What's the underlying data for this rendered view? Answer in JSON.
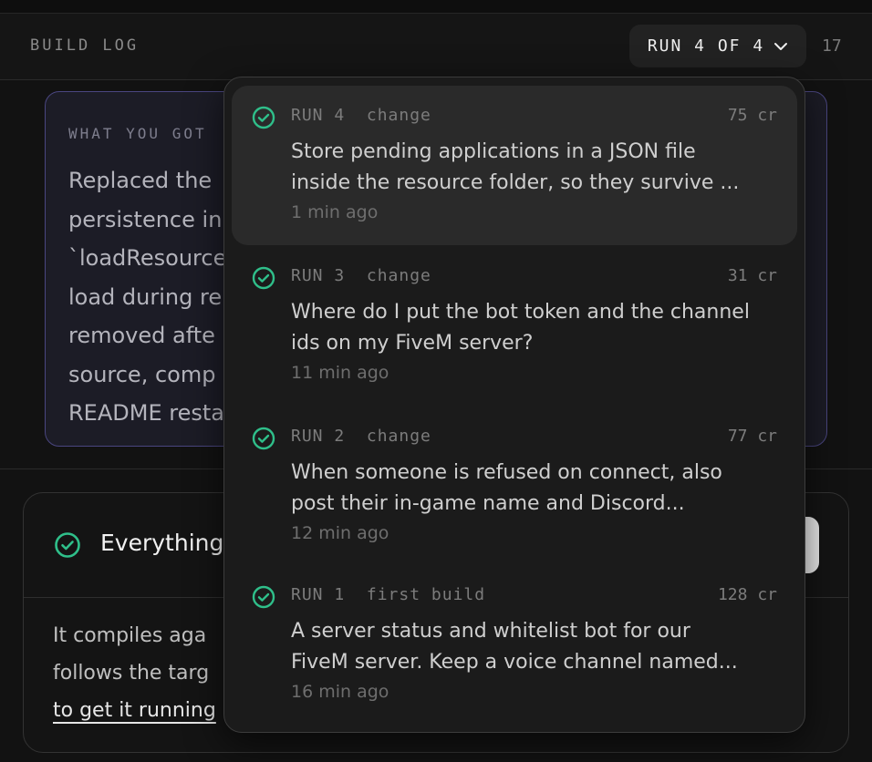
{
  "header": {
    "title": "BUILD LOG",
    "run_selector_label": "RUN 4 OF 4",
    "count": "17"
  },
  "info_card": {
    "label": "WHAT YOU GOT",
    "lines": [
      "Replaced the",
      "persistence in",
      "`loadResource",
      "load during re",
      "removed afte",
      "source, comp",
      "README resta"
    ]
  },
  "status_card": {
    "title": "Everything",
    "body_line1": "It compiles aga",
    "body_line2": "follows the targ",
    "link_text": "to get it running"
  },
  "runs": [
    {
      "label": "RUN 4",
      "kind": "change",
      "credits": "75 cr",
      "description_line1": "Store pending applications in a JSON file",
      "description_line2": "inside the resource folder, so they survive ...",
      "time": "1 min ago",
      "selected": true
    },
    {
      "label": "RUN 3",
      "kind": "change",
      "credits": "31 cr",
      "description_line1": "Where do I put the bot token and the channel",
      "description_line2": "ids on my FiveM server?",
      "time": "11 min ago",
      "selected": false
    },
    {
      "label": "RUN 2",
      "kind": "change",
      "credits": "77 cr",
      "description_line1": "When someone is refused on connect, also",
      "description_line2": "post their in-game name and Discord...",
      "time": "12 min ago",
      "selected": false
    },
    {
      "label": "RUN 1",
      "kind": "first build",
      "credits": "128 cr",
      "description_line1": "A server status and whitelist bot for our",
      "description_line2": "FiveM server. Keep a voice channel named...",
      "time": "16 min ago",
      "selected": false
    }
  ],
  "colors": {
    "success": "#2fbf8a",
    "accent_border": "#4a4680"
  },
  "icons": {
    "check": "check-circle-icon",
    "chevron": "chevron-down-icon"
  }
}
